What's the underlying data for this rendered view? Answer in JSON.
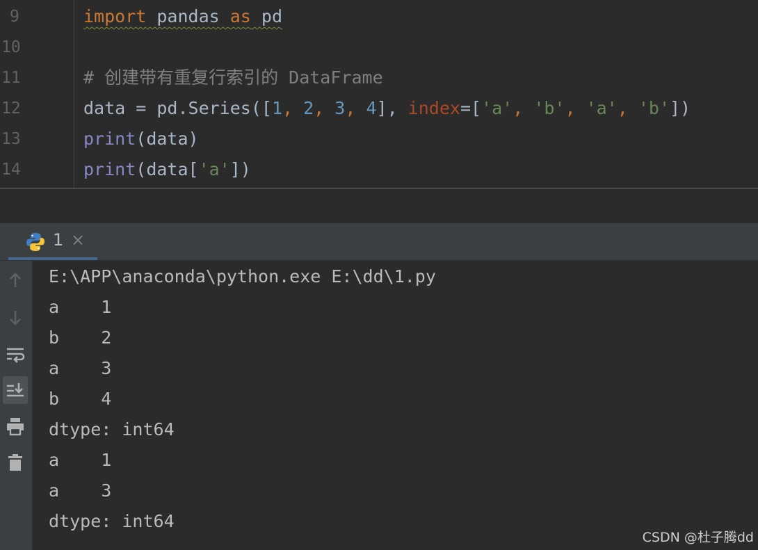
{
  "editor": {
    "line_numbers": [
      "9",
      "10",
      "11",
      "12",
      "13",
      "14"
    ],
    "line9": {
      "kw_import": "import",
      "mod": " pandas ",
      "kw_as": "as",
      "alias": " pd"
    },
    "line11": {
      "comment": "# 创建带有重复行索引的 DataFrame"
    },
    "line12": {
      "p1": "data = pd.Series([",
      "n1": "1",
      "c1": ", ",
      "n2": "2",
      "c2": ", ",
      "n3": "3",
      "c3": ", ",
      "n4": "4",
      "p2": "], ",
      "param": "index",
      "p3": "=[",
      "s1": "'a'",
      "c4": ", ",
      "s2": "'b'",
      "c5": ", ",
      "s3": "'a'",
      "c6": ", ",
      "s4": "'b'",
      "p4": "])"
    },
    "line13": {
      "fn": "print",
      "rest": "(data)"
    },
    "line14": {
      "fn": "print",
      "p1": "(data[",
      "s1": "'a'",
      "p2": "])"
    }
  },
  "run_panel": {
    "tab_label": "1",
    "tab_close": "×",
    "toolbar_icons": [
      "up-arrow-icon",
      "down-arrow-icon",
      "soft-wrap-icon",
      "scroll-to-end-icon",
      "print-icon",
      "trash-icon"
    ],
    "output_lines": [
      "E:\\APP\\anaconda\\python.exe E:\\dd\\1.py",
      "a    1",
      "b    2",
      "a    3",
      "b    4",
      "dtype: int64",
      "a    1",
      "a    3",
      "dtype: int64"
    ]
  },
  "watermark": "CSDN @杜子腾dd",
  "colors": {
    "keyword": "#cc7832",
    "builtin": "#8888c6",
    "number": "#6897bb",
    "string": "#6a8759",
    "param": "#aa4926",
    "comment": "#808080",
    "text": "#a9b7c6"
  }
}
